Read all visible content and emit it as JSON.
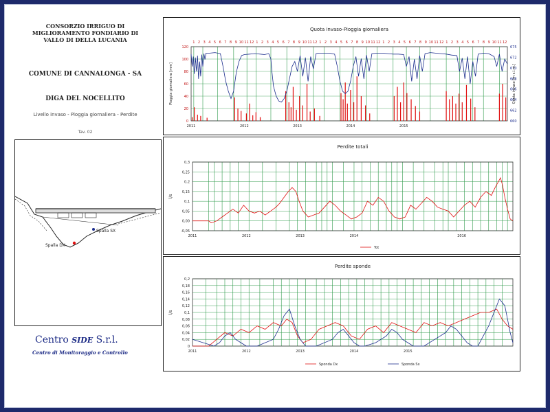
{
  "header": {
    "title_lines": [
      "CONSORZIO IRRIGUO DI",
      "MIGLIORAMENTO FONDIARIO DI",
      "VALLO DI DELLA LUCANIA"
    ],
    "comune": "COMUNE DI CANNALONGA - SA",
    "diga": "DIGA DEL NOCELLITO",
    "subtitle": "Livello invaso - Pioggia giornaliera - Perdite",
    "tavola": "Tav. 02"
  },
  "drawing": {
    "label_dx": "Spalla DX",
    "label_sx": "Spalla SX"
  },
  "logo": {
    "name_a": "Centro ",
    "name_b": "SIDE",
    "name_c": " S.r.l.",
    "tagline": "Centro di Monitoraggio e Controllo"
  },
  "colors": {
    "red": "#e01010",
    "blue": "#1a2c8c",
    "grid": "#2e9a4a",
    "frame": "#1e2a6b"
  },
  "chart_data": [
    {
      "type": "line",
      "title": "Quota invaso-Pioggia giornaliera",
      "ylabel": "Pioggia giornaliera [mm]",
      "y2label": "Quota invaso [m s.l.m.]",
      "ylim": [
        0,
        120
      ],
      "y2lim": [
        660,
        675
      ],
      "yticks": [
        "0",
        "20",
        "40",
        "60",
        "80",
        "100",
        "120"
      ],
      "y2ticks": [
        "660",
        "662",
        "664",
        "666",
        "668",
        "670",
        "672",
        "675"
      ],
      "xlim": [
        2011,
        2016.95
      ],
      "xticks": [
        "2011",
        "2012",
        "2013",
        "2014",
        "2015"
      ],
      "month_labels": [
        "1",
        "2",
        "3",
        "4",
        "5",
        "6",
        "7",
        "8",
        "9",
        "10",
        "11",
        "12",
        "1",
        "2",
        "3",
        "4",
        "5",
        "6",
        "7",
        "8",
        "9",
        "10",
        "11",
        "12",
        "1",
        "2",
        "3",
        "4",
        "5",
        "6",
        "7",
        "8",
        "9",
        "10",
        "11",
        "12",
        "1",
        "2",
        "3",
        "4",
        "5",
        "6",
        "7",
        "8",
        "9",
        "10",
        "11",
        "12",
        "1",
        "2",
        "3",
        "4",
        "5",
        "6",
        "7",
        "8",
        "9",
        "10",
        "11",
        "12"
      ],
      "vlines": [
        2011.05,
        2011.22,
        2011.5,
        2011.8,
        2012.05,
        2012.22,
        2012.5,
        2012.8,
        2013.05,
        2013.3,
        2013.5,
        2013.8,
        2014.05,
        2014.3,
        2014.5,
        2014.8,
        2015.05,
        2015.3,
        2015.5,
        2015.8,
        2016.05,
        2016.3,
        2016.5,
        2016.8
      ],
      "series": [
        {
          "color": "#1a2c8c",
          "axis": "right",
          "x": [
            2011.0,
            2011.02,
            2011.04,
            2011.06,
            2011.08,
            2011.1,
            2011.12,
            2011.14,
            2011.16,
            2011.18,
            2011.2,
            2011.22,
            2011.24,
            2011.26,
            2011.28,
            2011.35,
            2011.45,
            2011.5,
            2011.55,
            2011.6,
            2011.65,
            2011.7,
            2011.75,
            2011.8,
            2011.85,
            2011.9,
            2011.95,
            2012.0,
            2012.1,
            2012.2,
            2012.3,
            2012.38,
            2012.46,
            2012.5,
            2012.52,
            2012.55,
            2012.6,
            2012.65,
            2012.7,
            2012.75,
            2012.8,
            2012.85,
            2012.9,
            2012.95,
            2013.0,
            2013.05,
            2013.1,
            2013.15,
            2013.2,
            2013.25,
            2013.3,
            2013.35,
            2013.4,
            2013.5,
            2013.6,
            2013.7,
            2013.75,
            2013.8,
            2013.85,
            2013.9,
            2013.95,
            2014.0,
            2014.05,
            2014.1,
            2014.15,
            2014.2,
            2014.25,
            2014.3,
            2014.35,
            2014.4,
            2014.5,
            2014.6,
            2014.7,
            2014.8,
            2014.9,
            2015.0,
            2015.05,
            2015.1,
            2015.15,
            2015.2,
            2015.25,
            2015.3,
            2015.35,
            2015.4,
            2015.5,
            2015.6,
            2015.7,
            2015.8,
            2015.9,
            2016.0,
            2016.05,
            2016.1,
            2016.15,
            2016.2,
            2016.25,
            2016.3,
            2016.35,
            2016.4,
            2016.5,
            2016.6,
            2016.7,
            2016.75,
            2016.8,
            2016.85,
            2016.9,
            2016.95
          ],
          "values": [
            673.5,
            671,
            673,
            669.5,
            672.8,
            670,
            673.2,
            668.5,
            672,
            669,
            673.4,
            671,
            673.6,
            672.4,
            673.7,
            673.7,
            673.8,
            673.7,
            673.6,
            671,
            668,
            666,
            664.5,
            666,
            669.8,
            672,
            673.2,
            673.4,
            673.5,
            673.6,
            673.5,
            673.4,
            673.6,
            672.5,
            670,
            667,
            665,
            664,
            663.8,
            664.5,
            666,
            668.5,
            671,
            672,
            670,
            673.2,
            669,
            672.8,
            668,
            673,
            670.5,
            673.6,
            673.7,
            673.7,
            673.7,
            673.5,
            671,
            668,
            666,
            665.5,
            666,
            668,
            671,
            673,
            669,
            672.6,
            668.5,
            673.3,
            670,
            673.6,
            673.7,
            673.7,
            673.6,
            673.5,
            673.5,
            673.4,
            671,
            673,
            668,
            672.5,
            668.5,
            673.2,
            670,
            673.6,
            673.8,
            673.7,
            673.6,
            673.5,
            673.3,
            673.2,
            670,
            672.7,
            668.5,
            673,
            667.5,
            672,
            669,
            673.5,
            673.7,
            673.6,
            673,
            671,
            673.5,
            670,
            672.5,
            671.5
          ]
        },
        {
          "color": "#e01010",
          "axis": "left",
          "kind": "bars",
          "x": [
            2011.02,
            2011.06,
            2011.12,
            2011.18,
            2011.3,
            2011.82,
            2011.88,
            2011.94,
            2012.04,
            2012.1,
            2012.16,
            2012.22,
            2012.3,
            2012.78,
            2012.84,
            2012.88,
            2012.92,
            2012.98,
            2013.04,
            2013.1,
            2013.18,
            2013.24,
            2013.32,
            2013.42,
            2013.82,
            2013.86,
            2013.9,
            2013.94,
            2014.0,
            2014.06,
            2014.12,
            2014.2,
            2014.28,
            2014.36,
            2014.82,
            2014.88,
            2014.94,
            2015.0,
            2015.06,
            2015.14,
            2015.22,
            2015.3,
            2015.8,
            2015.86,
            2015.92,
            2015.98,
            2016.04,
            2016.1,
            2016.18,
            2016.26,
            2016.34,
            2016.8,
            2016.86,
            2016.92
          ],
          "values": [
            6,
            22,
            10,
            8,
            5,
            38,
            20,
            16,
            12,
            28,
            9,
            14,
            6,
            48,
            30,
            22,
            55,
            18,
            40,
            25,
            60,
            15,
            20,
            8,
            45,
            35,
            62,
            28,
            50,
            30,
            72,
            40,
            25,
            12,
            40,
            55,
            30,
            62,
            45,
            35,
            24,
            15,
            48,
            35,
            40,
            28,
            44,
            30,
            58,
            36,
            22,
            44,
            60,
            38
          ]
        }
      ]
    },
    {
      "type": "line",
      "title": "Perdite totali",
      "ylabel": "l/s",
      "ylim": [
        -0.05,
        0.3
      ],
      "yticks": [
        "-0,05",
        "0,00",
        "0,05",
        "0,1",
        "0,15",
        "0,2",
        "0,25",
        "0,3"
      ],
      "ytick_values": [
        -0.05,
        0,
        0.05,
        0.1,
        0.15,
        0.2,
        0.25,
        0.3
      ],
      "xlim": [
        2011,
        2016.95
      ],
      "xticks": [
        "2011",
        "2012",
        "2013",
        "2014",
        "2016"
      ],
      "xtick_values": [
        2011,
        2012,
        2013,
        2014,
        2016
      ],
      "legend": [
        "Tot"
      ],
      "vlines": [
        2011.3,
        2011.4,
        2011.55,
        2011.7,
        2011.85,
        2012.05,
        2012.3,
        2012.55,
        2012.8,
        2012.95,
        2013.1,
        2013.3,
        2013.4,
        2013.5,
        2013.6,
        2013.8,
        2014.0,
        2014.15,
        2014.3,
        2014.45,
        2014.6,
        2014.7,
        2014.8,
        2014.9,
        2015.1,
        2015.3,
        2015.5,
        2015.65,
        2015.75,
        2015.9,
        2016.05,
        2016.2,
        2016.35,
        2016.5,
        2016.65,
        2016.75,
        2016.85
      ],
      "series": [
        {
          "name": "Tot",
          "color": "#e01010",
          "x": [
            2011.0,
            2011.3,
            2011.35,
            2011.45,
            2011.55,
            2011.65,
            2011.75,
            2011.85,
            2011.95,
            2012.05,
            2012.15,
            2012.25,
            2012.35,
            2012.45,
            2012.55,
            2012.62,
            2012.7,
            2012.78,
            2012.85,
            2012.92,
            2012.98,
            2013.05,
            2013.15,
            2013.25,
            2013.35,
            2013.45,
            2013.55,
            2013.65,
            2013.75,
            2013.85,
            2013.95,
            2014.05,
            2014.15,
            2014.25,
            2014.35,
            2014.45,
            2014.55,
            2014.65,
            2014.75,
            2014.85,
            2014.95,
            2015.05,
            2015.15,
            2015.25,
            2015.35,
            2015.45,
            2015.55,
            2015.65,
            2015.75,
            2015.85,
            2015.95,
            2016.05,
            2016.15,
            2016.25,
            2016.35,
            2016.45,
            2016.55,
            2016.62,
            2016.68,
            2016.72,
            2016.76,
            2016.8,
            2016.85,
            2016.9,
            2016.95
          ],
          "values": [
            0.0,
            0.0,
            -0.01,
            0.0,
            0.02,
            0.04,
            0.06,
            0.04,
            0.08,
            0.05,
            0.04,
            0.05,
            0.03,
            0.05,
            0.07,
            0.09,
            0.12,
            0.15,
            0.17,
            0.15,
            0.1,
            0.05,
            0.02,
            0.03,
            0.04,
            0.07,
            0.1,
            0.08,
            0.05,
            0.03,
            0.01,
            0.02,
            0.04,
            0.1,
            0.08,
            0.12,
            0.1,
            0.05,
            0.02,
            0.01,
            0.02,
            0.08,
            0.06,
            0.09,
            0.12,
            0.1,
            0.07,
            0.06,
            0.05,
            0.02,
            0.05,
            0.08,
            0.1,
            0.07,
            0.12,
            0.15,
            0.13,
            0.17,
            0.2,
            0.22,
            0.18,
            0.12,
            0.06,
            0.01,
            0.0
          ]
        }
      ]
    },
    {
      "type": "line",
      "title": "Perdite sponde",
      "ylabel": "l/s",
      "ylim": [
        0,
        0.2
      ],
      "yticks": [
        "0",
        "0,02",
        "0,04",
        "0,06",
        "0,08",
        "0,1",
        "0,12",
        "0,14",
        "0,16",
        "0,18",
        "0,2"
      ],
      "ytick_values": [
        0,
        0.02,
        0.04,
        0.06,
        0.08,
        0.1,
        0.12,
        0.14,
        0.16,
        0.18,
        0.2
      ],
      "xlim": [
        2011,
        2016.95
      ],
      "xticks": [
        "2011",
        "2012",
        "2013",
        "2014",
        "2015"
      ],
      "xtick_values": [
        2011,
        2012,
        2013,
        2014,
        2015
      ],
      "legend": [
        "Sponda Dx",
        "Sponda Sx"
      ],
      "vlines": [
        2011.25,
        2011.45,
        2011.6,
        2011.75,
        2011.9,
        2012.05,
        2012.25,
        2012.5,
        2012.65,
        2012.8,
        2012.95,
        2013.1,
        2013.3,
        2013.45,
        2013.6,
        2013.75,
        2013.9,
        2014.05,
        2014.2,
        2014.35,
        2014.5,
        2014.65,
        2014.8,
        2014.95,
        2015.1,
        2015.25,
        2015.4,
        2015.55,
        2015.7,
        2015.85,
        2016.0,
        2016.15,
        2016.3,
        2016.45,
        2016.6,
        2016.75
      ],
      "series": [
        {
          "name": "Sponda Dx",
          "color": "#e01010",
          "x": [
            2011.0,
            2011.3,
            2011.45,
            2011.6,
            2011.75,
            2011.9,
            2012.05,
            2012.2,
            2012.35,
            2012.5,
            2012.65,
            2012.75,
            2012.85,
            2012.95,
            2013.05,
            2013.2,
            2013.35,
            2013.5,
            2013.65,
            2013.8,
            2013.95,
            2014.1,
            2014.25,
            2014.4,
            2014.55,
            2014.7,
            2014.85,
            2015.0,
            2015.15,
            2015.3,
            2015.45,
            2015.6,
            2015.75,
            2015.9,
            2016.05,
            2016.2,
            2016.35,
            2016.5,
            2016.65,
            2016.75,
            2016.85,
            2016.95
          ],
          "values": [
            0.0,
            0.0,
            0.02,
            0.04,
            0.03,
            0.05,
            0.04,
            0.06,
            0.05,
            0.07,
            0.06,
            0.08,
            0.07,
            0.03,
            0.01,
            0.02,
            0.05,
            0.06,
            0.07,
            0.06,
            0.03,
            0.02,
            0.05,
            0.06,
            0.04,
            0.07,
            0.06,
            0.05,
            0.04,
            0.07,
            0.06,
            0.07,
            0.06,
            0.07,
            0.08,
            0.09,
            0.1,
            0.1,
            0.11,
            0.08,
            0.06,
            0.05
          ]
        },
        {
          "name": "Sponda Sx",
          "color": "#1a2c8c",
          "x": [
            2011.0,
            2011.4,
            2011.5,
            2011.6,
            2011.7,
            2011.8,
            2011.9,
            2012.0,
            2012.2,
            2012.5,
            2012.6,
            2012.7,
            2012.8,
            2012.9,
            2013.0,
            2013.1,
            2013.3,
            2013.6,
            2013.7,
            2013.8,
            2013.9,
            2014.0,
            2014.1,
            2014.2,
            2014.4,
            2014.6,
            2014.7,
            2014.8,
            2014.9,
            2015.0,
            2015.1,
            2015.3,
            2015.5,
            2015.6,
            2015.7,
            2015.8,
            2015.9,
            2016.0,
            2016.1,
            2016.2,
            2016.3,
            2016.4,
            2016.5,
            2016.6,
            2016.7,
            2016.8,
            2016.9,
            2016.95
          ],
          "values": [
            0.02,
            0.0,
            0.01,
            0.03,
            0.04,
            0.02,
            0.01,
            0.0,
            0.0,
            0.02,
            0.05,
            0.09,
            0.11,
            0.06,
            0.02,
            0.0,
            0.0,
            0.02,
            0.04,
            0.05,
            0.03,
            0.01,
            0.0,
            0.0,
            0.01,
            0.03,
            0.05,
            0.04,
            0.02,
            0.01,
            0.0,
            0.0,
            0.02,
            0.03,
            0.04,
            0.06,
            0.05,
            0.03,
            0.01,
            0.0,
            0.0,
            0.03,
            0.06,
            0.1,
            0.14,
            0.12,
            0.04,
            0.01
          ]
        }
      ]
    }
  ]
}
